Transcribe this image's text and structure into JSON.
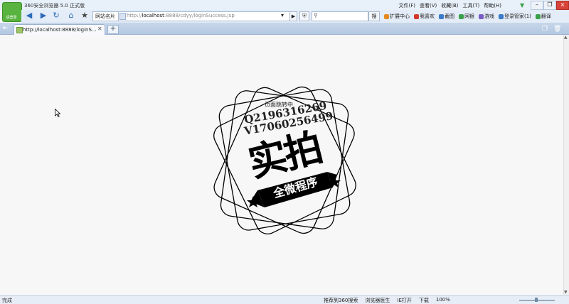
{
  "window": {
    "title": "360安全浏览器 5.0 正式版",
    "menu": [
      "文件(F)",
      "查看(V)",
      "收藏(B)",
      "工具(T)",
      "帮助(H)"
    ],
    "logo_label": "请登录"
  },
  "toolbar": {
    "favorites_label": "网站名片",
    "address": {
      "prefix": "http://",
      "host": "localhost",
      "path": ":8888/cdyy/loginSuccess.jsp"
    },
    "search_button": "搜",
    "tools": [
      {
        "label": "扩展中心",
        "color": "#e68a1f"
      },
      {
        "label": "我喜欢",
        "color": "#d33a2c"
      },
      {
        "label": "截图",
        "color": "#3b7bc9"
      },
      {
        "label": "网银",
        "color": "#3aa04a"
      },
      {
        "label": "游戏",
        "color": "#7b5cc4"
      },
      {
        "label": "登录管家(1)",
        "color": "#3b7bc9"
      },
      {
        "label": "翻译",
        "color": "#3aa04a"
      }
    ]
  },
  "tab": {
    "title": "http://localhost:8888/loginS..."
  },
  "content": {
    "loading_text": "页面跳转中",
    "stamp_line1": "Q2196316269",
    "stamp_line2": "V17060256499",
    "stamp_big": "实拍",
    "stamp_ribbon": "全微程序"
  },
  "statusbar": {
    "status": "完成",
    "items": [
      "推荐到360搜索",
      "浏览器医生",
      "IE打开",
      "下载"
    ],
    "zoom": "100%"
  }
}
